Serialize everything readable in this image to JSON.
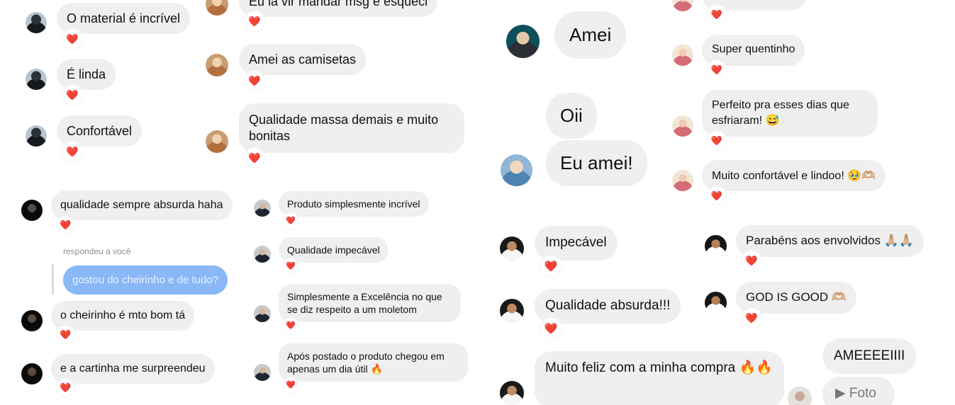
{
  "panel1": {
    "left": [
      {
        "text": "O material é incrível",
        "reaction": "❤️"
      },
      {
        "text": "É linda",
        "reaction": "❤️"
      },
      {
        "text": "Confortável",
        "reaction": "❤️"
      }
    ],
    "right": [
      {
        "text": "Eu ia vir mandar msg e esqueci",
        "reaction": "❤️"
      },
      {
        "text": "Amei as camisetas",
        "reaction": "❤️"
      },
      {
        "text": "Qualidade massa demais e muito bonitas",
        "reaction": "❤️"
      }
    ]
  },
  "panel2": {
    "m1": {
      "text": "qualidade sempre absurda haha",
      "reaction": "❤️"
    },
    "reply_label": "respondeu a você",
    "quoted": "gostou do cheirinho e de tudo?",
    "m2": {
      "text": "o cheirinho é mto bom tá",
      "reaction": "❤️"
    },
    "m3": {
      "text": "e a cartinha me surpreendeu",
      "reaction": "❤️"
    }
  },
  "panel3": [
    {
      "text": "Produto simplesmente incrível",
      "reaction": "❤️"
    },
    {
      "text": "Qualidade impecável",
      "reaction": "❤️"
    },
    {
      "text": "Simplesmente a Excelência no que se diz respeito a um moletom",
      "reaction": "❤️"
    },
    {
      "text": "Após postado o produto chegou em apenas um dia útil 🔥",
      "reaction": "❤️"
    }
  ],
  "panel4": {
    "amei": "Amei",
    "oii": "Oii",
    "eu_amei": "Eu amei!"
  },
  "panel5": [
    {
      "text": "",
      "reaction": "❤️"
    },
    {
      "text": "Super quentinho",
      "reaction": "❤️"
    },
    {
      "text": "Perfeito pra esses dias que esfriaram! 😅",
      "reaction": "❤️"
    },
    {
      "text": "Muito confortável e lindoo! 🥹🫶🏼",
      "reaction": "❤️"
    }
  ],
  "panel6": [
    {
      "text": "Impecável",
      "reaction": "❤️"
    },
    {
      "text": "Qualidade absurda!!!",
      "reaction": "❤️"
    },
    {
      "text": "Muito feliz com a minha compra 🔥🔥"
    }
  ],
  "panel7": [
    {
      "text": "Parabéns aos envolvidos 🙏🏼🙏🏼",
      "reaction": "❤️"
    },
    {
      "text": "GOD IS GOOD 🫶🏼",
      "reaction": "❤️"
    }
  ],
  "panel8": {
    "ameeee": "AMEEEEIIII",
    "foto": "▶ Foto"
  }
}
